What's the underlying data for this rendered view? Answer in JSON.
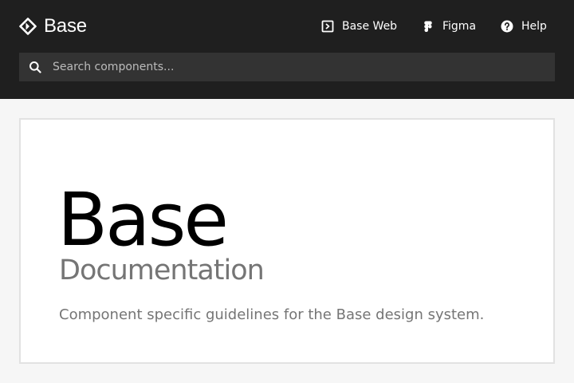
{
  "header": {
    "brand_name": "Base",
    "brand_icon": "base-diamond-logo-icon",
    "nav": [
      {
        "label": "Base Web",
        "icon": "code-box-icon"
      },
      {
        "label": "Figma",
        "icon": "figma-icon"
      },
      {
        "label": "Help",
        "icon": "help-circle-icon"
      }
    ]
  },
  "search": {
    "placeholder": "Search components...",
    "value": "",
    "icon": "search-icon"
  },
  "hero": {
    "title": "Base",
    "subtitle": "Documentation",
    "description": "Component specific guidelines for the Base design system."
  },
  "colors": {
    "header_bg": "#1f1f1f",
    "search_bg": "#333333",
    "page_bg": "#f6f6f6",
    "card_bg": "#ffffff",
    "title_text": "#000000",
    "muted_text": "#757575"
  }
}
